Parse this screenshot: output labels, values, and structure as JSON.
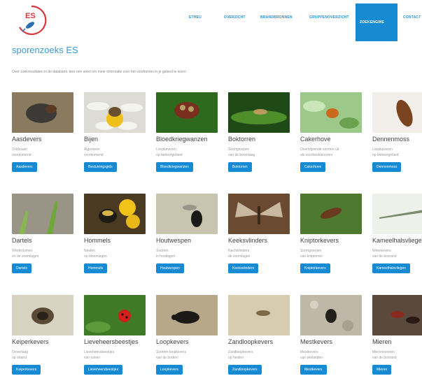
{
  "logo": {
    "text": "ES"
  },
  "nav": [
    {
      "label": "ETHEU"
    },
    {
      "label": "OVERZICHT"
    },
    {
      "label": "BRANDBRONNEN"
    },
    {
      "label": "GRUPPENOVERZICHT"
    },
    {
      "label": "ZOEKENGINE"
    },
    {
      "label": "CONTACT"
    }
  ],
  "page_title": "sporenzoeks ES",
  "breadcrumb": "Over zoekresultaten in de databank: kies een soort om meer informatie over het voorkomen in je gebied te lezen",
  "cards": [
    {
      "title": "Aasdevers",
      "desc": "Zeldzaam\nvoorkomend",
      "button": "Aasdevers"
    },
    {
      "title": "Bijen",
      "desc": "Algemeen\nvoorkomend",
      "button": "Bestuivingsgids"
    },
    {
      "title": "Bloedkriegwanzen",
      "desc": "Loopkeveren\nop beheergebied",
      "button": "Bloedkriegwanzen"
    },
    {
      "title": "Boktorren",
      "desc": "Soortgroepen\nvan de boomlaag",
      "button": "Boktorren"
    },
    {
      "title": "Cakerhove",
      "desc": "Overblijvende soorten uit\nals voorbeeldsoorten",
      "button": "Cakerhove"
    },
    {
      "title": "Dennenmoss",
      "desc": "Loopkeveren\nop beheergebied",
      "button": "Dennenmoss"
    },
    {
      "title": "Dartels",
      "desc": "Vlindertuinen\nen de zoomlagen",
      "button": "Dartels"
    },
    {
      "title": "Hommels",
      "desc": "Nesten\nop bloemlagen",
      "button": "Hommels"
    },
    {
      "title": "Houtwespen",
      "desc": "Soorten\nin houtlagen",
      "button": "Houtwespen"
    },
    {
      "title": "Keeksvlinders",
      "desc": "Nachtvlinders\nde zoomlagen",
      "button": "Keeksvlinders"
    },
    {
      "title": "Kniptorkevers",
      "desc": "Soortgroepen\nvan kniptorren",
      "button": "Kniptorkevers"
    },
    {
      "title": "Kameelhalsvliegen",
      "desc": "Weerkevers\nvan de bosrand",
      "button": "Kameelhalsvliegen"
    },
    {
      "title": "Keiperkevers",
      "desc": "Oeverlaag\nop strand",
      "button": "Keiperkevers"
    },
    {
      "title": "Lieveheersbeestjes",
      "desc": "Lieveheersbeestjes\nvan tuinen",
      "button": "Lieveheersbeestjes"
    },
    {
      "title": "Loopkevers",
      "desc": "Soorten loopkevers\nvan de bodem",
      "button": "Loopkevers"
    },
    {
      "title": "Zandloopkevers",
      "desc": "Zandloopkevers\nop heiden",
      "button": "Zandloopkevers"
    },
    {
      "title": "Mestkevers",
      "desc": "Mestkevers\nvan weilanden",
      "button": "Mestkevers"
    },
    {
      "title": "Mieren",
      "desc": "Mierensoorten\nvan de bosrand",
      "button": "Mieren"
    }
  ],
  "colors": {
    "accent": "#168ad3",
    "title": "#3a9bd6",
    "logo_red": "#d9363e",
    "logo_blue": "#2a6fb8"
  }
}
